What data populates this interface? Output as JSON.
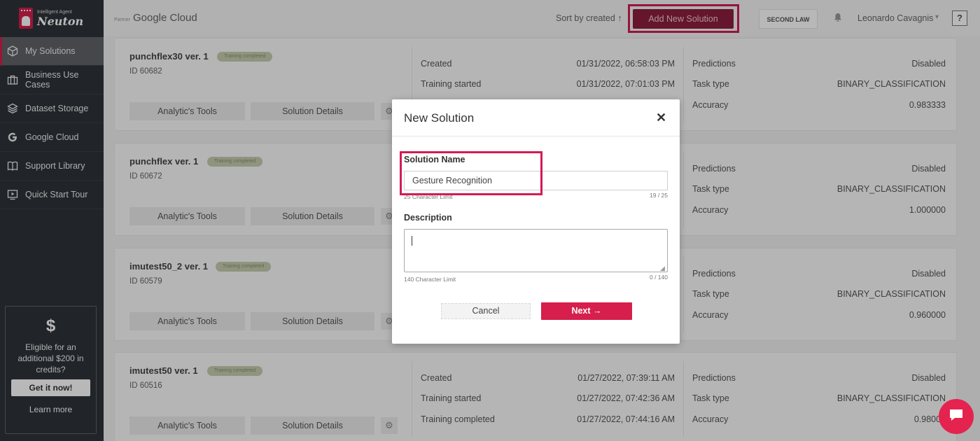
{
  "sidebar": {
    "logo": {
      "sub": "Intelligent Agent",
      "name": "Neuton"
    },
    "items": [
      {
        "label": "My Solutions",
        "icon": "cube-icon"
      },
      {
        "label": "Business Use Cases",
        "icon": "briefcase-icon"
      },
      {
        "label": "Dataset Storage",
        "icon": "layers-icon"
      },
      {
        "label": "Google Cloud",
        "icon": "google-icon"
      },
      {
        "label": "Support Library",
        "icon": "book-icon"
      },
      {
        "label": "Quick Start Tour",
        "icon": "play-screen-icon"
      }
    ],
    "promo": {
      "symbol": "$",
      "text": "Eligible for an additional $200 in credits?",
      "button": "Get it now!",
      "link": "Learn more"
    }
  },
  "header": {
    "partner": "Partner",
    "gcloud": "Google Cloud",
    "sort": "Sort by created ↑",
    "add_button": "Add New Solution",
    "org_button": "SECOND LAW",
    "user": "Leonardo Cavagnis",
    "help": "?"
  },
  "cards": [
    {
      "name": "punchflex30 ver. 1",
      "badge": "Training completed",
      "id": "ID 60682",
      "tools": "Analytic's Tools",
      "details": "Solution Details",
      "mid": [
        {
          "label": "Created",
          "value": "01/31/2022, 06:58:03 PM"
        },
        {
          "label": "Training started",
          "value": "01/31/2022, 07:01:03 PM"
        }
      ],
      "right": [
        {
          "label": "Predictions",
          "value": "Disabled"
        },
        {
          "label": "Task type",
          "value": "BINARY_CLASSIFICATION"
        },
        {
          "label": "Accuracy",
          "value": "0.983333"
        }
      ]
    },
    {
      "name": "punchflex ver. 1",
      "badge": "Training completed",
      "id": "ID 60672",
      "tools": "Analytic's Tools",
      "details": "Solution Details",
      "mid": [],
      "right": [
        {
          "label": "Predictions",
          "value": "Disabled"
        },
        {
          "label": "Task type",
          "value": "BINARY_CLASSIFICATION"
        },
        {
          "label": "Accuracy",
          "value": "1.000000"
        }
      ]
    },
    {
      "name": "imutest50_2 ver. 1",
      "badge": "Training completed",
      "id": "ID 60579",
      "tools": "Analytic's Tools",
      "details": "Solution Details",
      "mid": [],
      "right": [
        {
          "label": "Predictions",
          "value": "Disabled"
        },
        {
          "label": "Task type",
          "value": "BINARY_CLASSIFICATION"
        },
        {
          "label": "Accuracy",
          "value": "0.960000"
        }
      ]
    },
    {
      "name": "imutest50 ver. 1",
      "badge": "Training completed",
      "id": "ID 60516",
      "tools": "Analytic's Tools",
      "details": "Solution Details",
      "mid": [
        {
          "label": "Created",
          "value": "01/27/2022, 07:39:11 AM"
        },
        {
          "label": "Training started",
          "value": "01/27/2022, 07:42:36 AM"
        },
        {
          "label": "Training completed",
          "value": "01/27/2022, 07:44:16 AM"
        }
      ],
      "right": [
        {
          "label": "Predictions",
          "value": "Disabled"
        },
        {
          "label": "Task type",
          "value": "BINARY_CLASSIFICATION"
        },
        {
          "label": "Accuracy",
          "value": "0.98000"
        }
      ]
    }
  ],
  "modal": {
    "title": "New Solution",
    "close": "✕",
    "name_label": "Solution Name",
    "name_value": "Gesture Recognition",
    "name_hint": "25 Character Limit",
    "name_count": "19 / 25",
    "desc_label": "Description",
    "desc_value": "",
    "desc_hint": "140 Character Limit",
    "desc_count": "0 / 140",
    "cancel": "Cancel",
    "next": "Next →"
  },
  "colors": {
    "accent": "#d61f4c",
    "sidebar": "#2f343a",
    "highlight": "#d31c55"
  }
}
